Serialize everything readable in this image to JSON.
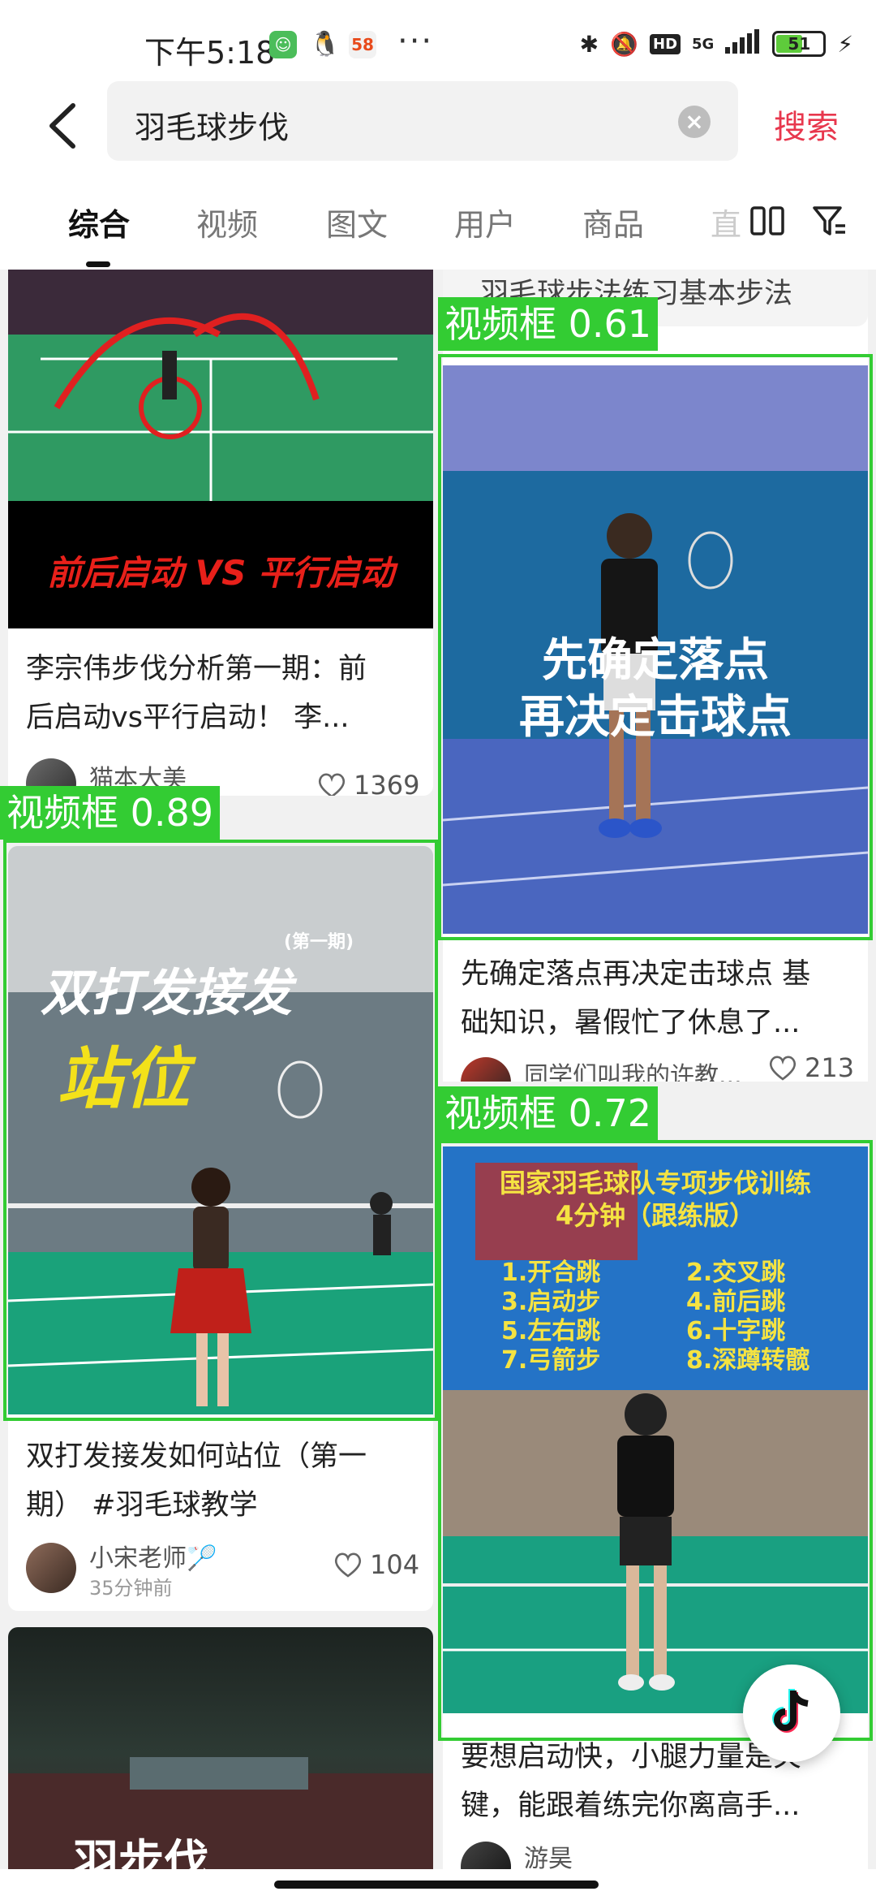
{
  "status_bar": {
    "time": "下午5:18",
    "app_badge_58": "58",
    "overflow": "···",
    "network": "5G",
    "hd_badge": "HD",
    "battery": "51"
  },
  "search": {
    "query": "羽毛球步伐",
    "search_button": "搜索"
  },
  "tabs": [
    "综合",
    "视频",
    "图文",
    "用户",
    "商品",
    "直"
  ],
  "cards": [
    {
      "overlay": "前后启动 VS 平行启动",
      "title_line1": "李宗伟步伐分析第一期：前",
      "title_line2": "后启动vs平行启动！ 李...",
      "author": "猫本大美",
      "likes": "1369"
    },
    {
      "partial_title": "羽毛球步法练习基本步法",
      "overlay_line1": "先确定落点",
      "overlay_line2": "再决定击球点",
      "title_line1": "先确定落点再决定击球点 基",
      "title_line2": "础知识，暑假忙了休息了...",
      "author": "同学们叫我的许教...",
      "likes": "213"
    },
    {
      "overlay_tag": "(第一期)",
      "overlay_line1": "双打发接发",
      "overlay_line2": "站位",
      "title_line1": "双打发接发如何站位（第一",
      "title_line2": "期） #羽毛球教学",
      "author": "小宋老师🏸",
      "time": "35分钟前",
      "likes": "104"
    },
    {
      "overlay_title1": "国家羽毛球队专项步伐训练",
      "overlay_title2": "4分钟（跟练版）",
      "drills": [
        "1.开合跳",
        "2.交叉跳",
        "3.启动步",
        "4.前后跳",
        "5.左右跳",
        "6.十字跳",
        "7.弓箭步",
        "8.深蹲转髋"
      ],
      "title_line1": "要想启动快，小腿力量是关",
      "title_line2": "键，能跟着练完你离高手...",
      "author": "游昊"
    },
    {
      "overlay": "羽步伐"
    }
  ],
  "detections": [
    {
      "label": "视频框 0.61"
    },
    {
      "label": "视频框 0.89"
    },
    {
      "label": "视频框 0.72"
    }
  ],
  "colors": {
    "accent": "#e8374d",
    "detection": "#33cc33"
  }
}
